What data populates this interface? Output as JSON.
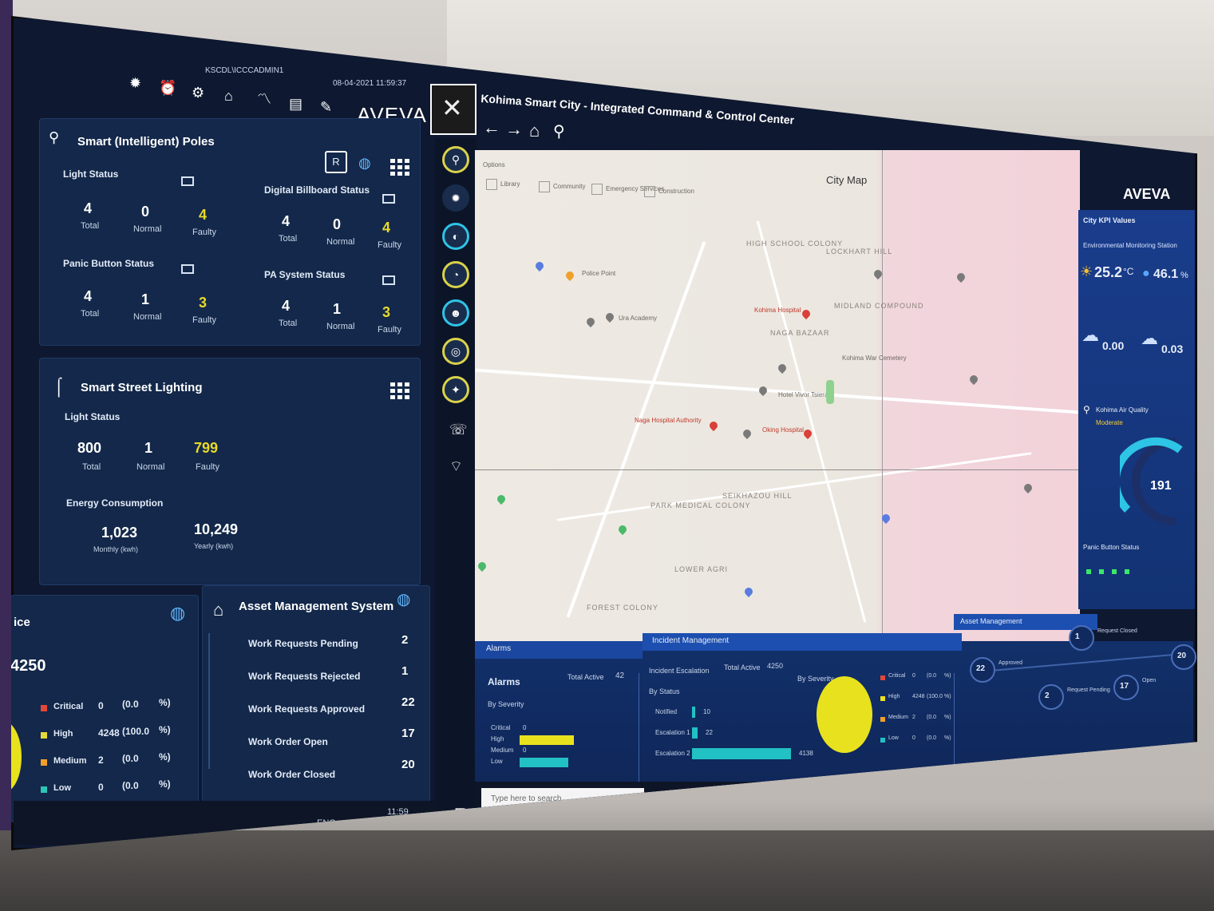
{
  "left_header": {
    "host": "KSCDL\\ICCCADMIN1",
    "datetime": "08-04-2021  11:59:37",
    "brand": "AVEVA",
    "icons": [
      "light-icon",
      "alarm-icon",
      "settings-icon",
      "asset-icon",
      "trend-icon",
      "report-icon",
      "edit-icon"
    ]
  },
  "smart_poles": {
    "title": "Smart (Intelligent) Poles",
    "light_status": {
      "label": "Light Status",
      "total": "4",
      "normal": "0",
      "faulty": "4"
    },
    "digital_billboard": {
      "label": "Digital Billboard Status",
      "total": "4",
      "normal": "0",
      "faulty": "4"
    },
    "panic_button": {
      "label": "Panic Button Status",
      "total": "4",
      "normal": "1",
      "faulty": "3"
    },
    "pa_system": {
      "label": "PA System Status",
      "total": "4",
      "normal": "1",
      "faulty": "3"
    },
    "labels": {
      "total": "Total",
      "normal": "Normal",
      "faulty": "Faulty"
    },
    "report_btn": "R"
  },
  "street_lighting": {
    "title": "Smart Street Lighting",
    "light_status_label": "Light Status",
    "total": "800",
    "normal": "1",
    "faulty": "799",
    "energy_label": "Energy Consumption",
    "monthly": "1,023",
    "monthly_label": "Monthly (kwh)",
    "yearly": "10,249",
    "yearly_label": "Yearly (kwh)"
  },
  "partial_panel": {
    "title": "ice",
    "total": "4250",
    "rows": [
      {
        "label": "Critical",
        "count": "0",
        "pct": "(0.0",
        "unit": "%)",
        "color": "#e2483a"
      },
      {
        "label": "High",
        "count": "4248",
        "pct": "(100.0",
        "unit": "%)",
        "color": "#e6d83a"
      },
      {
        "label": "Medium",
        "count": "2",
        "pct": "(0.0",
        "unit": "%)",
        "color": "#f0a02a"
      },
      {
        "label": "Low",
        "count": "0",
        "pct": "(0.0",
        "unit": "%)",
        "color": "#2ec4b6"
      }
    ]
  },
  "asset_mgmt": {
    "title": "Asset Management System",
    "rows": [
      {
        "label": "Work Requests Pending",
        "value": "2"
      },
      {
        "label": "Work Requests Rejected",
        "value": "1"
      },
      {
        "label": "Work Requests Approved",
        "value": "22"
      },
      {
        "label": "Work Order Open",
        "value": "17"
      },
      {
        "label": "Work Order Closed",
        "value": "20"
      }
    ]
  },
  "left_taskbar": {
    "time": "11:59",
    "date": "08-04-2021",
    "lang": "ENG"
  },
  "center_header": {
    "title": "Kohima Smart City - Integrated Command & Control Center",
    "map_title": "City Map",
    "filters": [
      "Library",
      "Community",
      "Emergency Services",
      "Construction"
    ],
    "options_label": "Options"
  },
  "map_labels": {
    "areas": [
      "HIGH SCHOOL COLONY",
      "LOCKHART HILL",
      "NAGA BAZAAR",
      "PARK MEDICAL COLONY",
      "LOWER AGRI",
      "FOREST COLONY",
      "SEIKHAZOU HILL",
      "MIDLAND COMPOUND"
    ],
    "places": [
      "Kohima Hospital",
      "Naga Hospital Authority",
      "Oking Hospital",
      "Hotel Vivor Tsiera",
      "Kohima War Cemetery",
      "Ura Academy",
      "Police Point"
    ]
  },
  "right_panel": {
    "title": "City KPI Values",
    "subtitle": "Environmental Monitoring Station",
    "temperature": "25.2",
    "temperature_unit": "°C",
    "humidity": "46.1",
    "humidity_unit": "%",
    "rain": "0.00",
    "wind": "0.03",
    "aqi_label": "Kohima Air Quality",
    "aqi_status": "Moderate",
    "aqi_value": "191",
    "aqi_level": 0.64,
    "panic_label": "Panic Button Status",
    "brand": "AVEVA"
  },
  "alarms": {
    "title": "Alarms",
    "sub": "Alarms",
    "total_active_label": "Total Active",
    "total_active": "42",
    "by_severity": "By Severity",
    "rows": [
      {
        "label": "Critical",
        "value": "0",
        "fill": 0.0,
        "color": "#e2483a"
      },
      {
        "label": "High",
        "value": "19",
        "fill": 0.62,
        "color": "#e8e21e"
      },
      {
        "label": "Medium",
        "value": "0",
        "fill": 0.0,
        "color": "#f0a02a"
      },
      {
        "label": "Low",
        "value": "24",
        "fill": 0.55,
        "color": "#22c1c3"
      }
    ]
  },
  "incident": {
    "title": "Incident Management",
    "escalation_label": "Incident Escalation",
    "total_active_label": "Total Active",
    "total_active": "4250",
    "by_status": "By Status",
    "by_severity": "By Severity",
    "status_rows": [
      {
        "label": "Notified",
        "value": "10",
        "fill": 0.03
      },
      {
        "label": "Escalation 1",
        "value": "22",
        "fill": 0.05
      },
      {
        "label": "Escalation 2",
        "value": "4138",
        "fill": 0.95
      }
    ],
    "legend": [
      {
        "label": "Critical",
        "value": "0",
        "pct": "(0.0",
        "unit": "%)",
        "color": "#e2483a"
      },
      {
        "label": "High",
        "value": "4248",
        "pct": "(100.0",
        "unit": "%)",
        "color": "#e8e21e"
      },
      {
        "label": "Medium",
        "value": "2",
        "pct": "(0.0",
        "unit": "%)",
        "color": "#f0a02a"
      },
      {
        "label": "Low",
        "value": "0",
        "pct": "(0.0",
        "unit": "%)",
        "color": "#22c1c3"
      }
    ]
  },
  "asset_flow": {
    "title": "Asset Management",
    "nodes": [
      {
        "label": "Approved",
        "value": "22"
      },
      {
        "label": "Request Closed",
        "value": "1"
      },
      {
        "label": "Request Pending",
        "value": "2"
      },
      {
        "label": "Open",
        "value": "17"
      },
      {
        "label": "Closed",
        "value": "20"
      }
    ]
  },
  "center_taskbar": {
    "search_placeholder": "Type here to search"
  }
}
